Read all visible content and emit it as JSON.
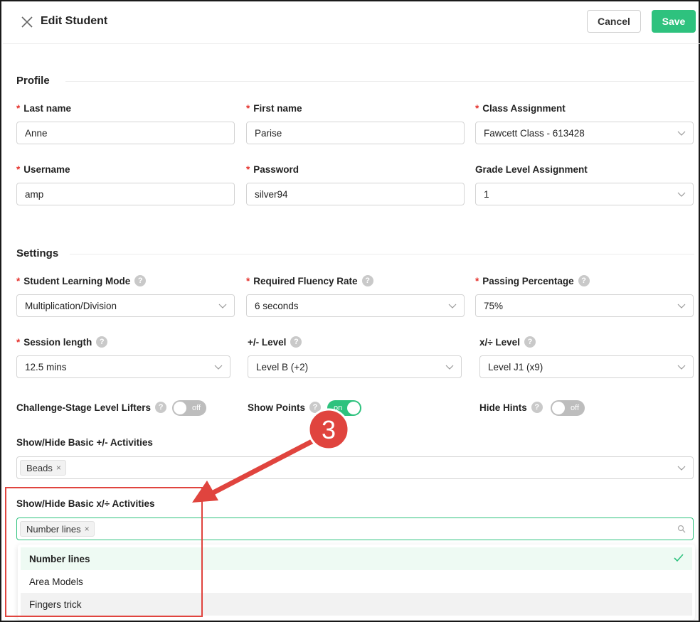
{
  "header": {
    "title": "Edit Student",
    "cancel_label": "Cancel",
    "save_label": "Save"
  },
  "profile": {
    "title": "Profile",
    "last_name": {
      "label": "Last name",
      "value": "Anne"
    },
    "first_name": {
      "label": "First name",
      "value": "Parise"
    },
    "class_assignment": {
      "label": "Class Assignment",
      "value": "Fawcett Class - 613428"
    },
    "username": {
      "label": "Username",
      "value": "amp"
    },
    "password": {
      "label": "Password",
      "value": "silver94"
    },
    "grade_level": {
      "label": "Grade Level Assignment",
      "value": "1"
    }
  },
  "settings": {
    "title": "Settings",
    "learning_mode": {
      "label": "Student Learning Mode",
      "value": "Multiplication/Division"
    },
    "fluency_rate": {
      "label": "Required Fluency Rate",
      "value": "6 seconds"
    },
    "passing_percentage": {
      "label": "Passing Percentage",
      "value": "75%"
    },
    "session_length": {
      "label": "Session length",
      "value": "12.5 mins"
    },
    "plus_minus_level": {
      "label": "+/- Level",
      "value": "Level B (+2)"
    },
    "times_div_level": {
      "label": "x/÷ Level",
      "value": "Level J1 (x9)"
    },
    "level_lifters": {
      "label": "Challenge-Stage Level Lifters",
      "state": "off"
    },
    "show_points": {
      "label": "Show Points",
      "state": "on"
    },
    "hide_hints": {
      "label": "Hide Hints",
      "state": "off"
    },
    "basic_plus_minus": {
      "label": "Show/Hide Basic +/- Activities",
      "tags": [
        "Beads"
      ]
    },
    "basic_times_div": {
      "label": "Show/Hide Basic x/÷ Activities",
      "tags": [
        "Number lines"
      ],
      "options": [
        "Number lines",
        "Area Models",
        "Fingers trick"
      ]
    }
  },
  "icons": {
    "help": "?",
    "tag_remove": "×"
  },
  "annotation": {
    "step_number": "3",
    "color": "#e0443e"
  },
  "colors": {
    "accent": "#2ec27e",
    "required": "#e5322d"
  }
}
